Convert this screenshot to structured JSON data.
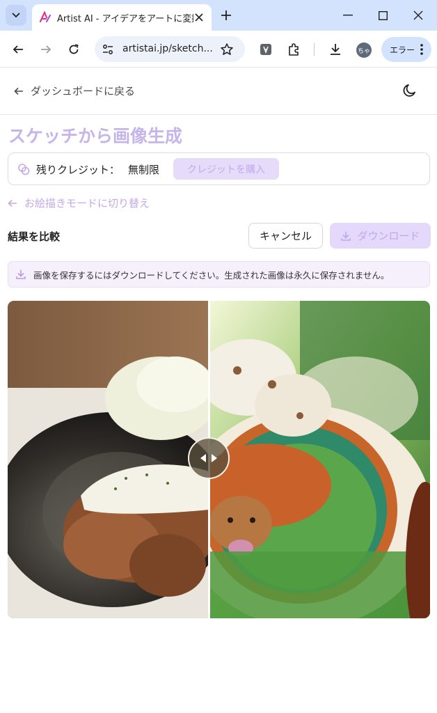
{
  "browser": {
    "tab_title": "Artist AI - アイデアをアートに変換",
    "url": "artistai.jp/sketch...",
    "profile_initials": "ちゃ",
    "error_chip_label": "エラー"
  },
  "header": {
    "back_label": "ダッシュボードに戻る"
  },
  "page": {
    "title": "スケッチから画像生成",
    "credits_label": "残りクレジット：",
    "credits_value": "無制限",
    "buy_credits_label": "クレジットを購入",
    "mode_switch_label": "お絵描きモードに切り替え",
    "compare_label": "結果を比較",
    "cancel_label": "キャンセル",
    "download_label": "ダウンロード",
    "notice_text": "画像を保存するにはダウンロードしてください。生成された画像は永久に保存されません。"
  },
  "colors": {
    "accent": "#c5b5ea",
    "accent_bg": "#e6dcfa",
    "notice_bg": "#f6effc",
    "chrome_tabbar": "#d3e3fd"
  },
  "icons": [
    "tab-list-icon",
    "favicon-icon",
    "close-icon",
    "plus-icon",
    "minimize-icon",
    "maximize-icon",
    "back-arrow-icon",
    "forward-arrow-icon",
    "reload-icon",
    "site-info-icon",
    "star-icon",
    "translate-icon",
    "extensions-icon",
    "download-icon",
    "kebab-icon",
    "moon-icon",
    "credits-icon",
    "arrow-left-icon",
    "swap-arrows-icon"
  ]
}
